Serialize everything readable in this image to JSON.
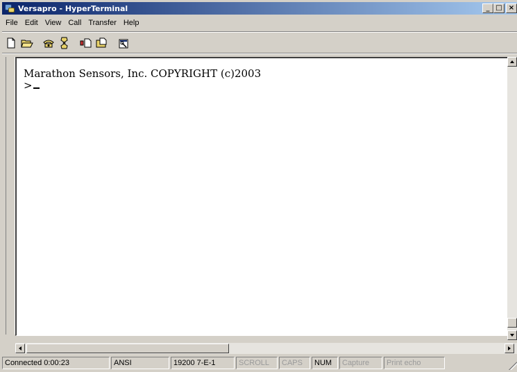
{
  "window": {
    "title": "Versapro - HyperTerminal",
    "controls": {
      "minimize": "_",
      "maximize": "□",
      "close": "×"
    }
  },
  "menu": {
    "items": [
      "File",
      "Edit",
      "View",
      "Call",
      "Transfer",
      "Help"
    ]
  },
  "toolbar": {
    "buttons": [
      {
        "icon": "new-document-icon"
      },
      {
        "icon": "open-folder-icon"
      },
      {
        "icon": "dial-phone-icon"
      },
      {
        "icon": "disconnect-icon"
      },
      {
        "icon": "send-file-icon"
      },
      {
        "icon": "receive-file-icon"
      },
      {
        "icon": "properties-icon"
      }
    ]
  },
  "terminal": {
    "line1": "Marathon Sensors, Inc. COPYRIGHT (c)2003",
    "prompt": ">"
  },
  "statusbar": {
    "connected": "Connected 0:00:23",
    "emulation": "ANSI",
    "settings": "19200 7-E-1",
    "scroll": "SCROLL",
    "caps": "CAPS",
    "num": "NUM",
    "capture": "Capture",
    "print_echo": "Print echo"
  },
  "colors": {
    "titlebar_start": "#0a246a",
    "titlebar_end": "#a6caf0",
    "face": "#d4d0c8",
    "terminal_bg": "#ffffff"
  }
}
